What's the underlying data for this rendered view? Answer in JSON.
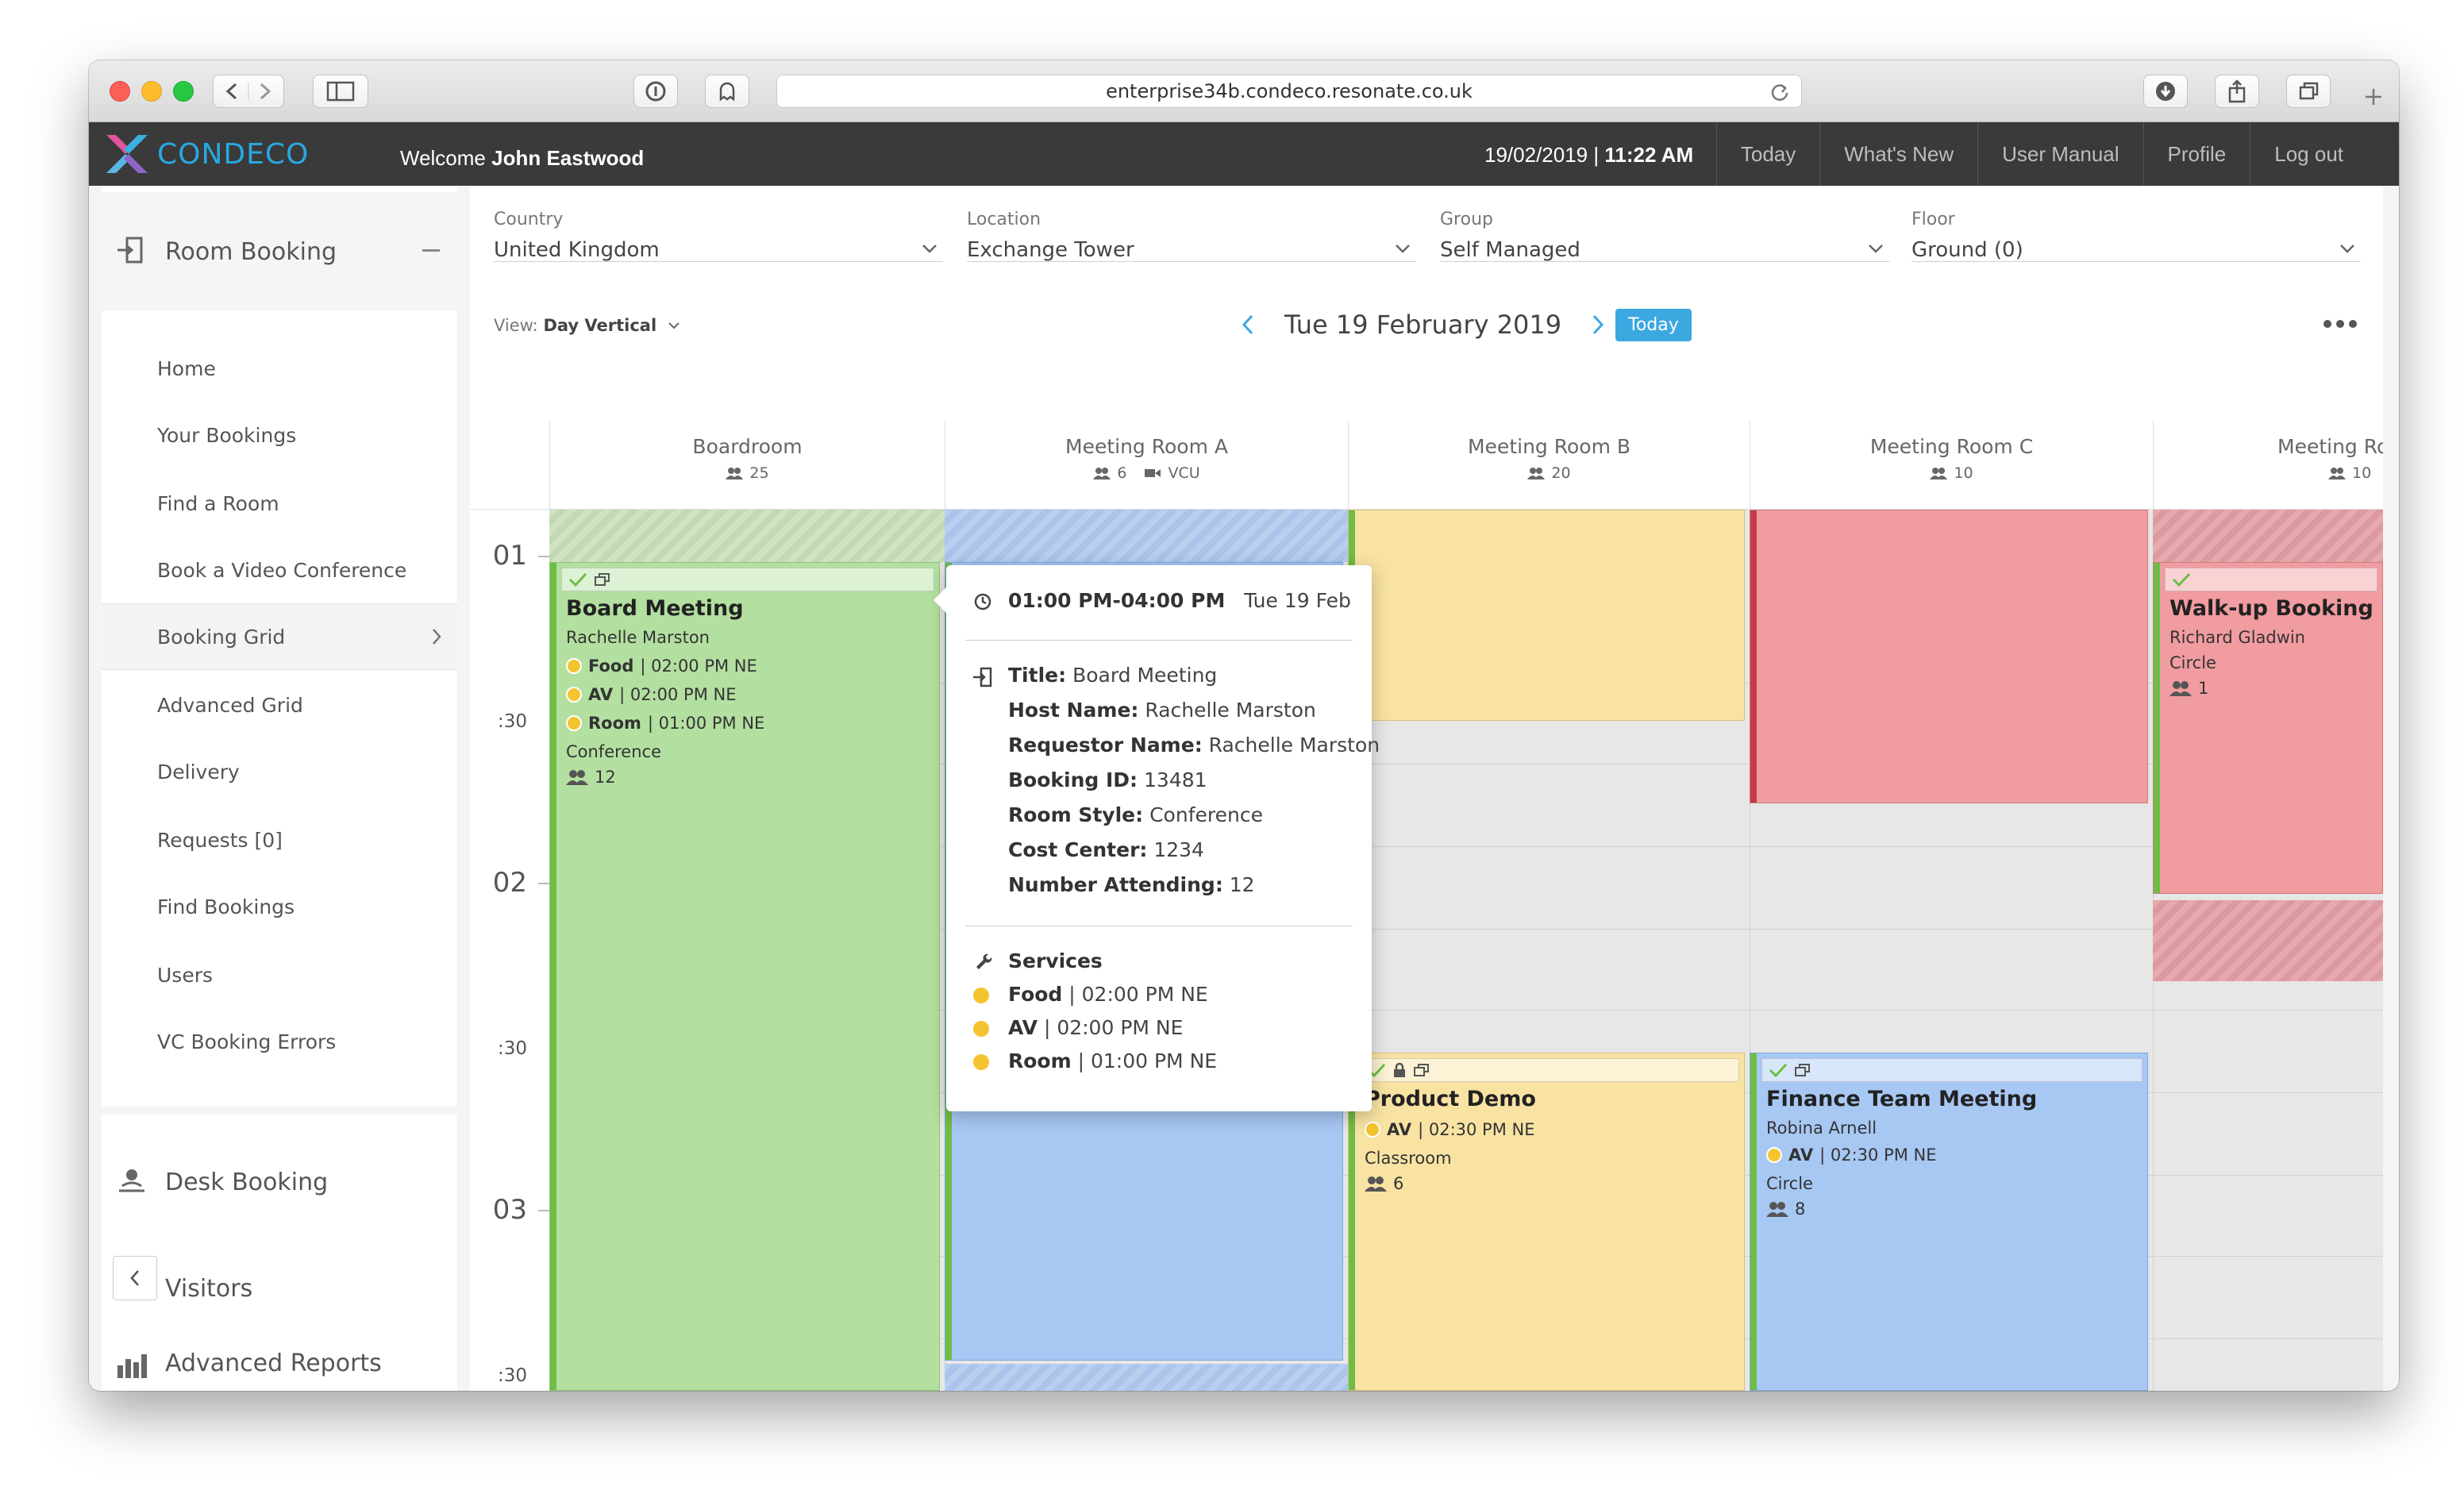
{
  "browser": {
    "url": "enterprise34b.condeco.resonate.co.uk"
  },
  "header": {
    "logo_text": "CONDECO",
    "welcome_prefix": "Welcome",
    "user_name": "John Eastwood",
    "date": "19/02/2019 |",
    "time": "11:22 AM",
    "nav": [
      "Today",
      "What's New",
      "User Manual",
      "Profile",
      "Log out"
    ]
  },
  "sidebar": {
    "room_booking": "Room Booking",
    "items": [
      "Home",
      "Your Bookings",
      "Find a Room",
      "Book a Video Conference",
      "Booking Grid",
      "Advanced Grid",
      "Delivery",
      "Requests [0]",
      "Find Bookings",
      "Users",
      "VC Booking Errors"
    ],
    "desk_booking": "Desk Booking",
    "visitors": "Visitors",
    "advanced_reports": "Advanced Reports"
  },
  "filters": {
    "country": {
      "label": "Country",
      "value": "United Kingdom"
    },
    "location": {
      "label": "Location",
      "value": "Exchange Tower"
    },
    "group": {
      "label": "Group",
      "value": "Self Managed"
    },
    "floor": {
      "label": "Floor",
      "value": "Ground (0)"
    }
  },
  "view": {
    "label": "View:",
    "value": "Day Vertical"
  },
  "date_nav": {
    "date": "Tue 19 February 2019",
    "today": "Today"
  },
  "rooms": [
    {
      "name": "Boardroom",
      "capacity": "25",
      "extra": ""
    },
    {
      "name": "Meeting Room A",
      "capacity": "6",
      "extra": "VCU"
    },
    {
      "name": "Meeting Room B",
      "capacity": "20",
      "extra": ""
    },
    {
      "name": "Meeting Room C",
      "capacity": "10",
      "extra": ""
    },
    {
      "name": "Meeting Roo",
      "capacity": "10",
      "extra": ""
    }
  ],
  "times": [
    "01",
    ":30",
    "02",
    ":30",
    "03",
    ":30"
  ],
  "bookings": {
    "board": {
      "title": "Board Meeting",
      "host": "Rachelle Marston",
      "services": [
        {
          "name": "Food",
          "detail": "| 02:00 PM NE"
        },
        {
          "name": "AV",
          "detail": "| 02:00 PM NE"
        },
        {
          "name": "Room",
          "detail": "| 01:00 PM NE"
        }
      ],
      "style": "Conference",
      "attendees": "12"
    },
    "walkup": {
      "title": "Walk-up Booking",
      "host": "Richard Gladwin",
      "style": "Circle",
      "attendees": "1"
    },
    "product": {
      "title": "Product Demo",
      "service_name": "AV",
      "service_detail": "| 02:30 PM NE",
      "style": "Classroom",
      "attendees": "6"
    },
    "finance": {
      "title": "Finance Team Meeting",
      "host": "Robina Arnell",
      "service_name": "AV",
      "service_detail": "| 02:30 PM NE",
      "style": "Circle",
      "attendees": "8"
    }
  },
  "tooltip": {
    "time": "01:00 PM-04:00 PM",
    "date": "Tue 19 Feb",
    "title_label": "Title:",
    "title": "Board Meeting",
    "host_label": "Host Name:",
    "host": "Rachelle Marston",
    "requestor_label": "Requestor Name:",
    "requestor": "Rachelle Marston",
    "id_label": "Booking ID:",
    "id": "13481",
    "style_label": "Room Style:",
    "style": "Conference",
    "cost_label": "Cost Center:",
    "cost": "1234",
    "attending_label": "Number Attending:",
    "attending": "12",
    "services_label": "Services",
    "services": [
      {
        "name": "Food",
        "detail": "| 02:00 PM NE"
      },
      {
        "name": "AV",
        "detail": "| 02:00 PM NE"
      },
      {
        "name": "Room",
        "detail": "| 01:00 PM NE"
      }
    ]
  },
  "colors": {
    "accent": "#3ca8e0",
    "green_booking": "#b3e0a0",
    "blue_booking": "#a8c8f4",
    "yellow_booking": "#f8e3a3",
    "red_booking": "#f19ca0",
    "status_green": "#6ebd45",
    "status_red": "#c43a4a",
    "service_dot": "#f4c430"
  }
}
